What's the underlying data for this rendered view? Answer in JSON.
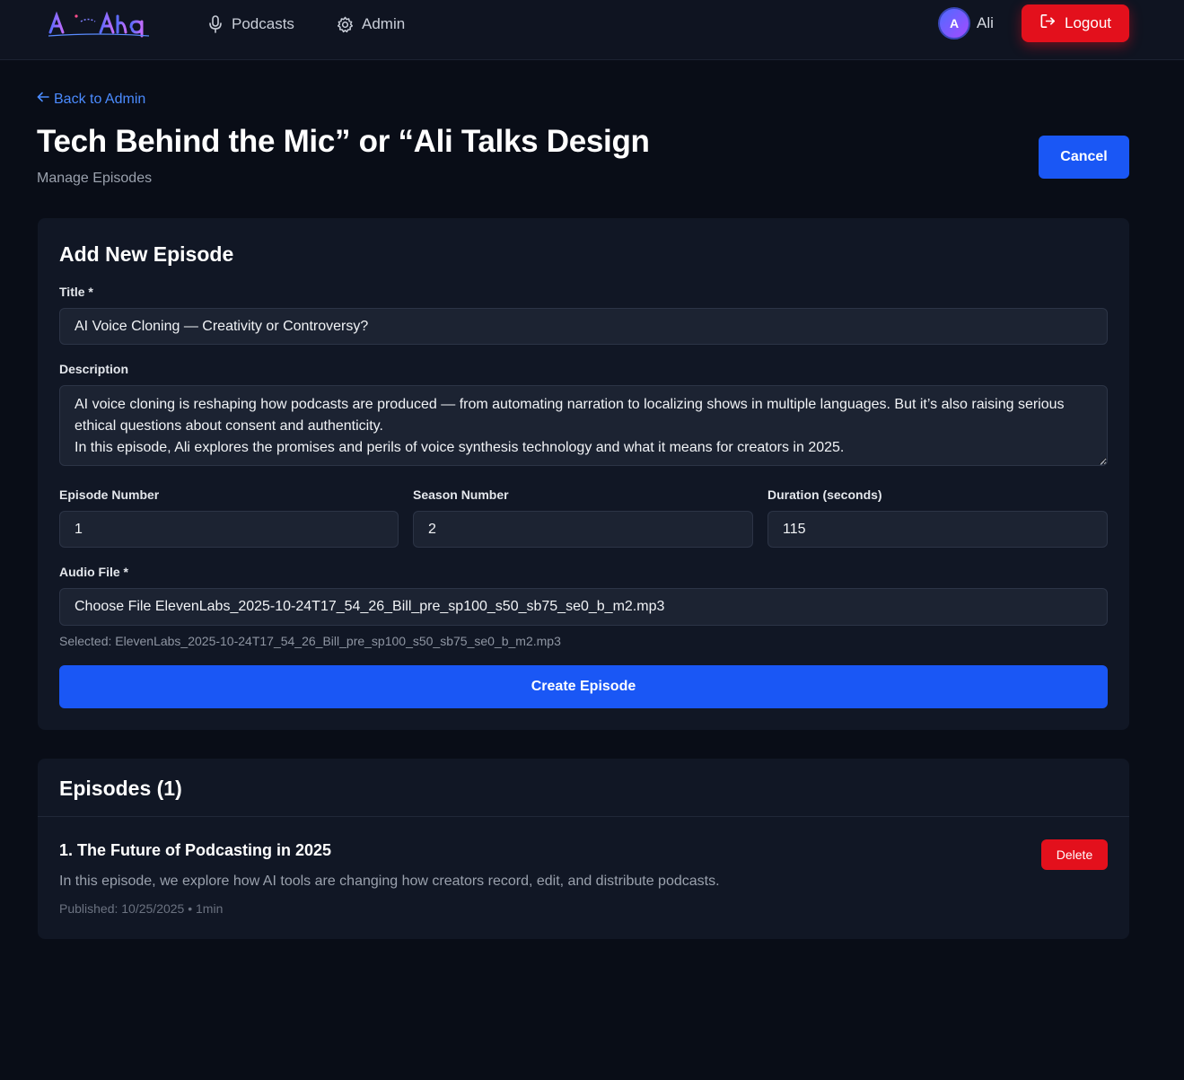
{
  "nav": {
    "logo_text": "AI Aha",
    "items": [
      {
        "label": "Podcasts",
        "icon": "microphone-icon"
      },
      {
        "label": "Admin",
        "icon": "gear-icon"
      }
    ],
    "user": {
      "initial": "A",
      "name": "Ali"
    },
    "logout_label": "Logout"
  },
  "header": {
    "back_label": "Back to Admin",
    "title": "Tech Behind the Mic” or “Ali Talks Design",
    "subtitle": "Manage Episodes",
    "cancel_label": "Cancel"
  },
  "form": {
    "heading": "Add New Episode",
    "title_label": "Title *",
    "title_value": "AI Voice Cloning — Creativity or Controversy?",
    "description_label": "Description",
    "description_value": "AI voice cloning is reshaping how podcasts are produced — from automating narration to localizing shows in multiple languages. But it’s also raising serious ethical questions about consent and authenticity.\nIn this episode, Ali explores the promises and perils of voice synthesis technology and what it means for creators in 2025.",
    "episode_number_label": "Episode Number",
    "episode_number_value": "1",
    "season_number_label": "Season Number",
    "season_number_value": "2",
    "duration_label": "Duration (seconds)",
    "duration_value": "115",
    "audio_label": "Audio File *",
    "audio_value": "Choose File ElevenLabs_2025-10-24T17_54_26_Bill_pre_sp100_s50_sb75_se0_b_m2.mp3",
    "selected_note": "Selected: ElevenLabs_2025-10-24T17_54_26_Bill_pre_sp100_s50_sb75_se0_b_m2.mp3",
    "submit_label": "Create Episode"
  },
  "episodes": {
    "heading": "Episodes (1)",
    "items": [
      {
        "title": "1. The Future of Podcasting in 2025",
        "description": "In this episode, we explore how AI tools are changing how creators record, edit, and distribute podcasts.",
        "meta": "Published: 10/25/2025 • 1min",
        "delete_label": "Delete"
      }
    ]
  },
  "colors": {
    "background": "#090d17",
    "panel": "#111725",
    "primary": "#1a57f5",
    "danger": "#e3101c",
    "link": "#4b8bff"
  }
}
